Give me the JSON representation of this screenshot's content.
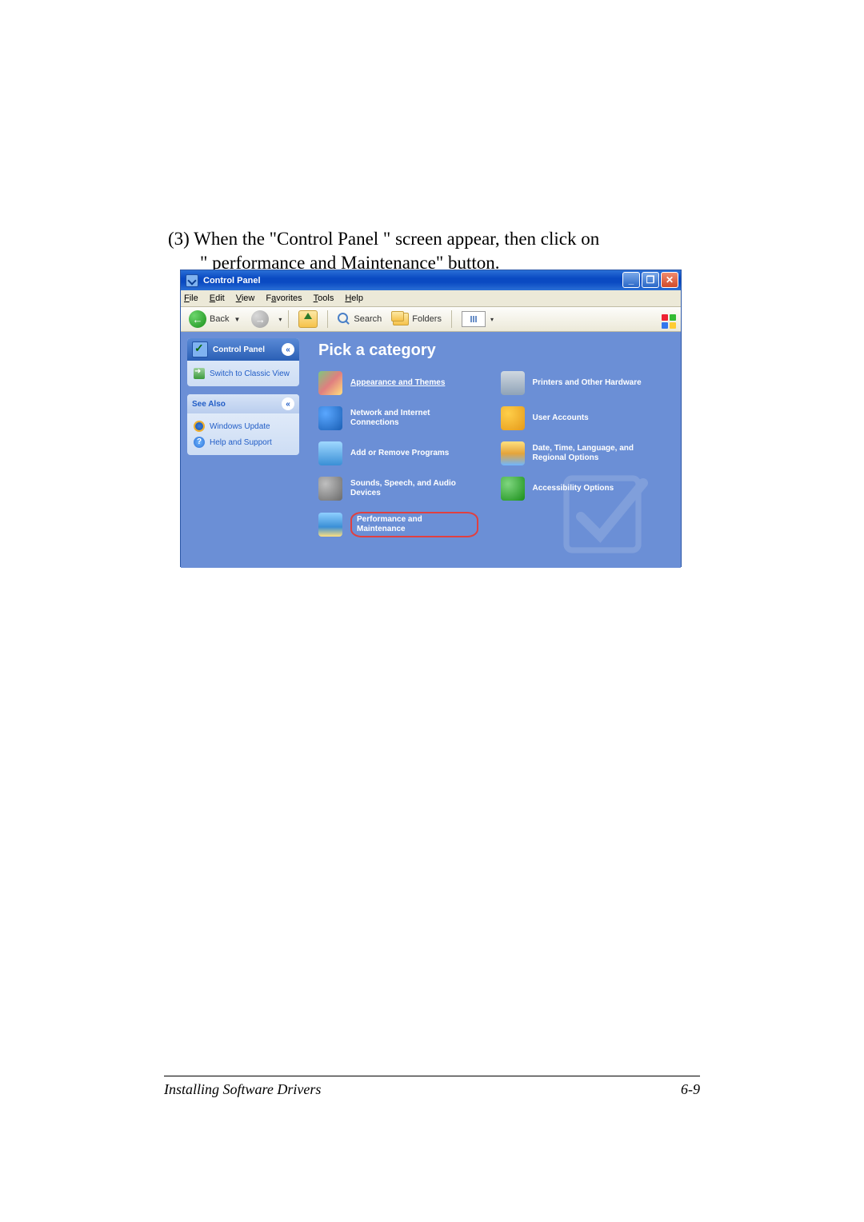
{
  "body": {
    "line1": "(3) When the \"Control Panel \" screen appear, then click on",
    "line2": "\" performance and Maintenance\" button."
  },
  "window": {
    "title": "Control Panel",
    "minimize": "_",
    "maximize": "❐",
    "close": "✕"
  },
  "menu": {
    "file": "File",
    "edit": "Edit",
    "view": "View",
    "favorites": "Favorites",
    "tools": "Tools",
    "help": "Help"
  },
  "toolbar": {
    "back": "Back",
    "search": "Search",
    "folders": "Folders"
  },
  "sidebar": {
    "cp_title": "Control Panel",
    "switch_view": "Switch to Classic View",
    "see_also": "See Also",
    "windows_update": "Windows Update",
    "help_support": "Help and Support"
  },
  "categories": {
    "heading": "Pick a category",
    "appearance": "Appearance and Themes",
    "printers": "Printers and Other Hardware",
    "network": "Network and Internet Connections",
    "users": "User Accounts",
    "addremove": "Add or Remove Programs",
    "date": "Date, Time, Language, and Regional Options",
    "sounds": "Sounds, Speech, and Audio Devices",
    "access": "Accessibility Options",
    "performance": "Performance and Maintenance"
  },
  "footer": {
    "left": "Installing Software Drivers",
    "right": "6-9"
  }
}
